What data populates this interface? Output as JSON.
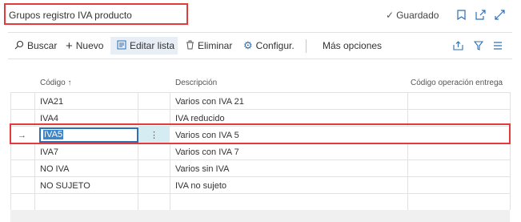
{
  "title": "Grupos registro IVA producto",
  "header": {
    "saved_label": "Guardado"
  },
  "toolbar": {
    "search_label": "Buscar",
    "new_label": "Nuevo",
    "edit_list_label": "Editar lista",
    "delete_label": "Eliminar",
    "configure_label": "Configur.",
    "more_options_label": "Más opciones"
  },
  "table": {
    "columns": [
      "Código ↑",
      "Descripción",
      "Código operación entrega"
    ],
    "rows": [
      {
        "code": "IVA21",
        "description": "Varios con IVA 21",
        "op_code": ""
      },
      {
        "code": "IVA4",
        "description": "IVA reducido",
        "op_code": ""
      },
      {
        "code": "IVA5",
        "description": "Varios con IVA 5",
        "op_code": ""
      },
      {
        "code": "IVA7",
        "description": "Varios con IVA 7",
        "op_code": ""
      },
      {
        "code": "NO IVA",
        "description": "Varios sin IVA",
        "op_code": ""
      },
      {
        "code": "NO SUJETO",
        "description": "IVA no sujeto",
        "op_code": ""
      }
    ],
    "selected_row_arrow": "→",
    "row_menu_glyph": "⋮"
  },
  "colors": {
    "accent": "#2f6fb3",
    "highlight": "#e33b3b",
    "active_toolbar": "#e8eef6"
  }
}
